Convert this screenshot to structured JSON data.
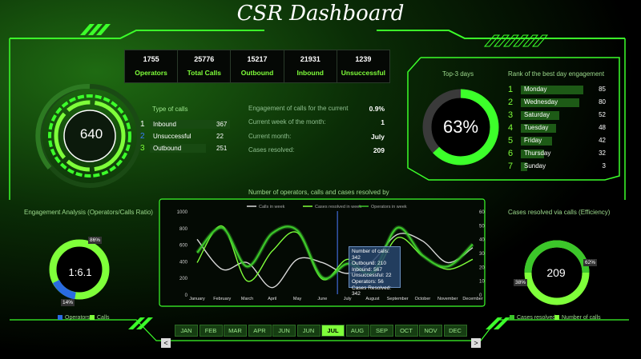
{
  "title": "CSR Dashboard",
  "kpis": [
    {
      "value": "1755",
      "label": "Operators"
    },
    {
      "value": "25776",
      "label": "Total Calls"
    },
    {
      "value": "15217",
      "label": "Outbound"
    },
    {
      "value": "21931",
      "label": "Inbound"
    },
    {
      "value": "1239",
      "label": "Unsuccessful"
    }
  ],
  "main_gauge": {
    "value": "640"
  },
  "type_of_calls": {
    "title": "Type of calls",
    "rows": [
      {
        "n": "1",
        "label": "Inbound",
        "value": "367"
      },
      {
        "n": "2",
        "label": "Unsuccessful",
        "value": "22"
      },
      {
        "n": "3",
        "label": "Outbound",
        "value": "251"
      }
    ]
  },
  "engagement_info": [
    {
      "label": "Engagement of calls for the current",
      "value": "0.9%"
    },
    {
      "label": "Current week of the month:",
      "value": "1"
    },
    {
      "label": "Current month:",
      "value": "July"
    },
    {
      "label": "Cases resolved:",
      "value": "209"
    }
  ],
  "top3": {
    "title": "Top-3 days",
    "value": "63%",
    "fraction": 0.63
  },
  "rank": {
    "title": "Rank of the best day engagement",
    "rows": [
      {
        "n": "1",
        "day": "Monday",
        "value": "85"
      },
      {
        "n": "2",
        "day": "Wednesday",
        "value": "80"
      },
      {
        "n": "3",
        "day": "Saturday",
        "value": "52"
      },
      {
        "n": "4",
        "day": "Tuesday",
        "value": "48"
      },
      {
        "n": "5",
        "day": "Friday",
        "value": "42"
      },
      {
        "n": "6",
        "day": "Thursday",
        "value": "32"
      },
      {
        "n": "7",
        "day": "Sunday",
        "value": "3"
      }
    ]
  },
  "engagement_analysis": {
    "title": "Engagement Analysis (Operators/Calls Ratio)",
    "value": "1:6.1",
    "pct_calls": "86%",
    "pct_operators": "14%",
    "legend": [
      "Operators",
      "Calls"
    ]
  },
  "efficiency": {
    "title": "Cases resolved via calls (Efficiency)",
    "value": "209",
    "pct_calls": "62%",
    "pct_resolved": "38%",
    "legend": [
      "Cases resolved",
      "Number of calls"
    ]
  },
  "chart_title": "Number of operators, calls and cases resolved by",
  "chart_data": {
    "type": "line",
    "categories": [
      "January",
      "February",
      "March",
      "April",
      "May",
      "June",
      "July",
      "August",
      "September",
      "October",
      "November",
      "December"
    ],
    "yleft": {
      "ticks": [
        "0",
        "200",
        "400",
        "600",
        "800",
        "1000"
      ],
      "ylim": [
        0,
        1000
      ]
    },
    "yright": {
      "ticks": [
        "0",
        "10",
        "20",
        "30",
        "40",
        "50",
        "60"
      ],
      "ylim": [
        0,
        60
      ]
    },
    "series": [
      {
        "name": "Calls in week",
        "axis": "left",
        "color": "#d8d8d8",
        "values": [
          660,
          300,
          380,
          80,
          420,
          380,
          250,
          400,
          720,
          640,
          380,
          560
        ]
      },
      {
        "name": "Cases resolved in week",
        "axis": "left",
        "color": "#7fff3a",
        "values": [
          380,
          820,
          160,
          520,
          740,
          180,
          420,
          240,
          680,
          460,
          300,
          420
        ]
      },
      {
        "name": "Operators in week",
        "axis": "right",
        "color": "#3cc62a",
        "values": [
          30,
          48,
          20,
          44,
          46,
          12,
          22,
          16,
          48,
          28,
          20,
          36
        ]
      }
    ]
  },
  "tooltip": {
    "lines": [
      "Number of calls: 342",
      "Outbound: 210",
      "Inbound: 567",
      "Unsuccessful: 22",
      "Operators: 56",
      "Cases Resolved: 342"
    ]
  },
  "months": [
    "JAN",
    "FEB",
    "MAR",
    "APR",
    "JUN",
    "JUN",
    "JUL",
    "AUG",
    "SEP",
    "OCT",
    "NOV",
    "DEC"
  ],
  "active_month": "JUL",
  "nav": {
    "prev": "<",
    "next": ">"
  }
}
